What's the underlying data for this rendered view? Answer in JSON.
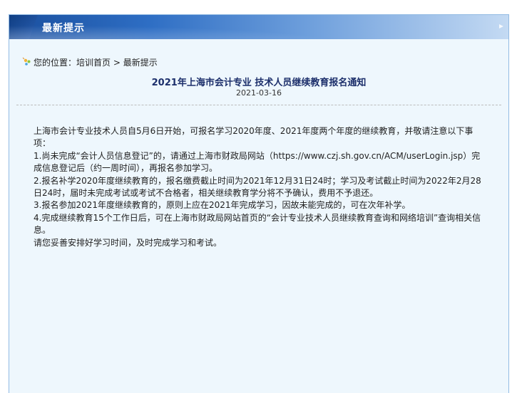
{
  "header": {
    "title": "最新提示"
  },
  "breadcrumb": {
    "prefix": "您的位置：",
    "home": "培训首页",
    "separator": " > ",
    "current": "最新提示"
  },
  "article": {
    "title": "2021年上海市会计专业 技术人员继续教育报名通知",
    "date": "2021-03-16",
    "paragraphs": [
      "上海市会计专业技术人员自5月6日开始，可报名学习2020年度、2021年度两个年度的继续教育，并敬请注意以下事项：",
      "1.尚未完成“会计人员信息登记”的，请通过上海市财政局网站（https://www.czj.sh.gov.cn/ACM/userLogin.jsp）完成信息登记后（约一周时间），再报名参加学习。",
      "2.报名补学2020年度继续教育的，报名缴费截止时间为2021年12月31日24时；学习及考试截止时间为2022年2月28日24时，届时未完成考试或考试不合格者，相关继续教育学分将不予确认，费用不予退还。",
      "3.报名参加2021年度继续教育的，原则上应在2021年完成学习，因故未能完成的，可在次年补学。",
      "4.完成继续教育15个工作日后，可在上海市财政局网站首页的“会计专业技术人员继续教育查询和网络培训”查询相关信息。",
      "请您妥善安排好学习时间，及时完成学习和考试。"
    ]
  },
  "colors": {
    "panel_background": "#eef7fd",
    "panel_border": "#93bbe3",
    "header_start": "#1a4f9e",
    "header_end": "#c4daf3",
    "title_color": "#1c2f6b"
  },
  "icons": {
    "breadcrumb": "location-pin-icon",
    "header_corner": "chevron-icon"
  }
}
